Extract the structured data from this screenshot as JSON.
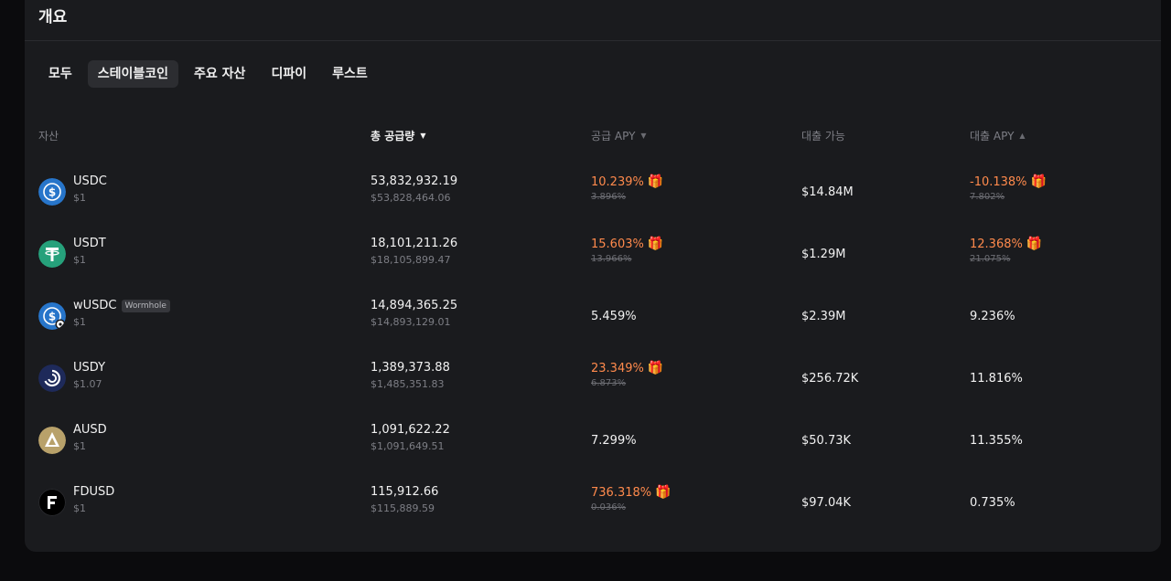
{
  "panel": {
    "title": "개요"
  },
  "tabs": [
    {
      "label": "모두",
      "active": false
    },
    {
      "label": "스테이블코인",
      "active": true
    },
    {
      "label": "주요 자산",
      "active": false
    },
    {
      "label": "디파이",
      "active": false
    },
    {
      "label": "루스트",
      "active": false
    }
  ],
  "columns": {
    "asset": "자산",
    "total_supply": "총 공급량",
    "supply_apy": "공급 APY",
    "borrowable": "대출 가능",
    "borrow_apy": "대출 APY"
  },
  "rows": [
    {
      "name": "USDC",
      "price": "$1",
      "supply": "53,832,932.19",
      "supply_usd": "$53,828,464.06",
      "supply_apy": "10.239%",
      "supply_apy_old": "3.896%",
      "borrowable": "$14.84M",
      "borrow_apy": "-10.138%",
      "borrow_apy_old": "7.802%"
    },
    {
      "name": "USDT",
      "price": "$1",
      "supply": "18,101,211.26",
      "supply_usd": "$18,105,899.47",
      "supply_apy": "15.603%",
      "supply_apy_old": "13.966%",
      "borrowable": "$1.29M",
      "borrow_apy": "12.368%",
      "borrow_apy_old": "21.075%"
    },
    {
      "name": "wUSDC",
      "badge": "Wormhole",
      "price": "$1",
      "supply": "14,894,365.25",
      "supply_usd": "$14,893,129.01",
      "supply_apy": "5.459%",
      "borrowable": "$2.39M",
      "borrow_apy": "9.236%"
    },
    {
      "name": "USDY",
      "price": "$1.07",
      "supply": "1,389,373.88",
      "supply_usd": "$1,485,351.83",
      "supply_apy": "23.349%",
      "supply_apy_old": "6.873%",
      "borrowable": "$256.72K",
      "borrow_apy": "11.816%"
    },
    {
      "name": "AUSD",
      "price": "$1",
      "supply": "1,091,622.22",
      "supply_usd": "$1,091,649.51",
      "supply_apy": "7.299%",
      "borrowable": "$50.73K",
      "borrow_apy": "11.355%"
    },
    {
      "name": "FDUSD",
      "price": "$1",
      "supply": "115,912.66",
      "supply_usd": "$115,889.59",
      "supply_apy": "736.318%",
      "supply_apy_old": "0.036%",
      "borrowable": "$97.04K",
      "borrow_apy": "0.735%"
    }
  ],
  "colors": {
    "panel_bg": "#1a1b1e",
    "boost_orange": "#ff8a4c",
    "muted_text": "#7d7e85",
    "usdc_blue": "#2775ca",
    "usdt_green": "#26a17b",
    "usdy_navy": "#1e2a5a",
    "ausd_gold": "#b8a16a",
    "fdusd_black": "#000000"
  },
  "icons": {
    "asset_icons": [
      "usdc-icon",
      "usdt-icon",
      "wusdc-icon",
      "usdy-icon",
      "ausd-icon",
      "fdusd-icon"
    ],
    "boost": "gift-icon",
    "sort_desc": "sort-desc-icon",
    "sort_neutral": "sort-icon"
  }
}
